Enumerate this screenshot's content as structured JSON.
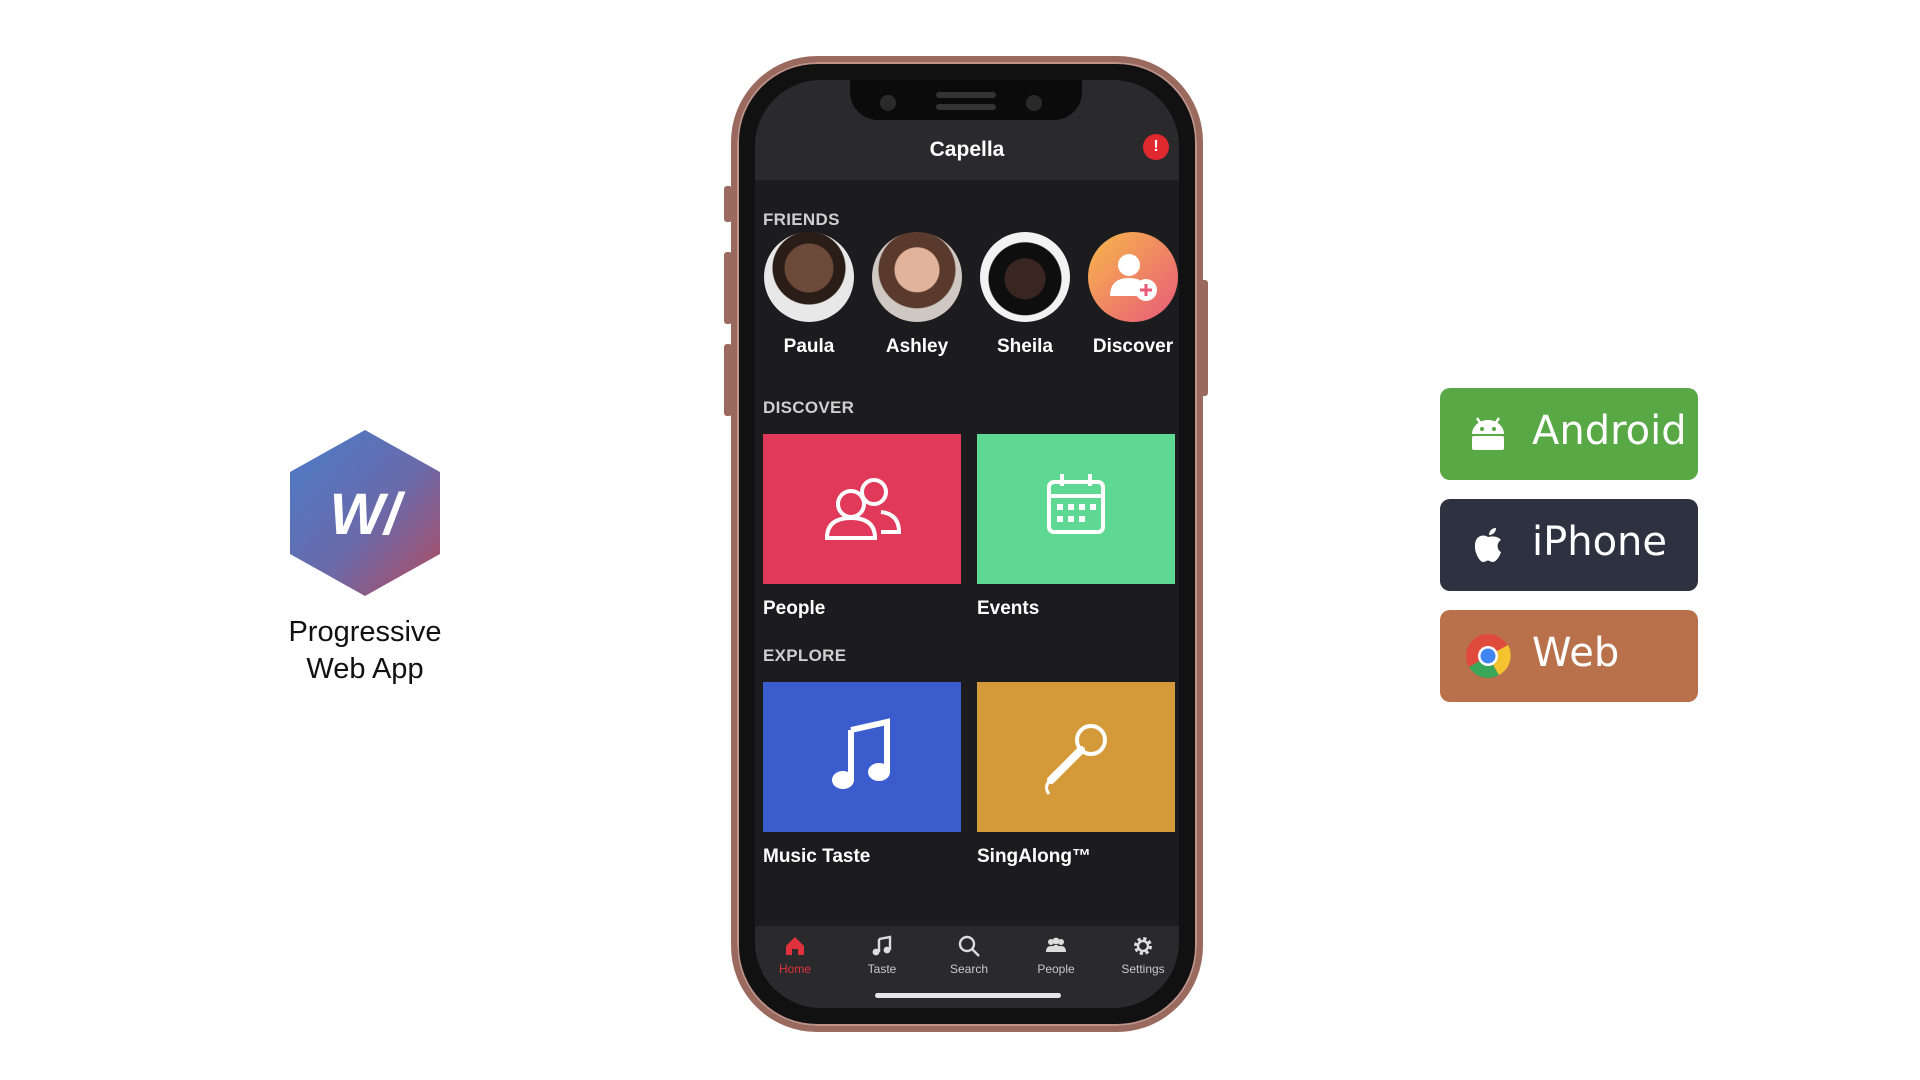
{
  "pwa": {
    "logo_letters": "W/",
    "caption_line1": "Progressive",
    "caption_line2": "Web App"
  },
  "app": {
    "title": "Capella",
    "alert_glyph": "!",
    "sections": {
      "friends": "FRIENDS",
      "discover": "DISCOVER",
      "explore": "EXPLORE"
    },
    "friends": [
      {
        "name": "Paula",
        "icon": "avatar-photo"
      },
      {
        "name": "Ashley",
        "icon": "avatar-photo"
      },
      {
        "name": "Sheila",
        "icon": "avatar-photo"
      },
      {
        "name": "Discover",
        "icon": "add-person-icon"
      }
    ],
    "discover_tiles": [
      {
        "label": "People",
        "icon": "people-icon",
        "color": "#e0395a"
      },
      {
        "label": "Events",
        "icon": "calendar-icon",
        "color": "#5fd894"
      }
    ],
    "explore_tiles": [
      {
        "label": "Music Taste",
        "icon": "music-note-icon",
        "color": "#3b5ccc"
      },
      {
        "label": "SingAlong™",
        "icon": "microphone-icon",
        "color": "#d49a3a"
      }
    ],
    "tabs": [
      {
        "label": "Home",
        "icon": "home-icon",
        "active": true
      },
      {
        "label": "Taste",
        "icon": "music-note-icon",
        "active": false
      },
      {
        "label": "Search",
        "icon": "search-icon",
        "active": false
      },
      {
        "label": "People",
        "icon": "people-icon",
        "active": false
      },
      {
        "label": "Settings",
        "icon": "gear-icon",
        "active": false
      }
    ],
    "accent_color": "#e0313c"
  },
  "platforms": [
    {
      "label": "Android",
      "icon": "android-icon",
      "color": "#58a945"
    },
    {
      "label": "iPhone",
      "icon": "apple-icon",
      "color": "#2e3240"
    },
    {
      "label": "Web",
      "icon": "chrome-icon",
      "color": "#b8714a"
    }
  ]
}
